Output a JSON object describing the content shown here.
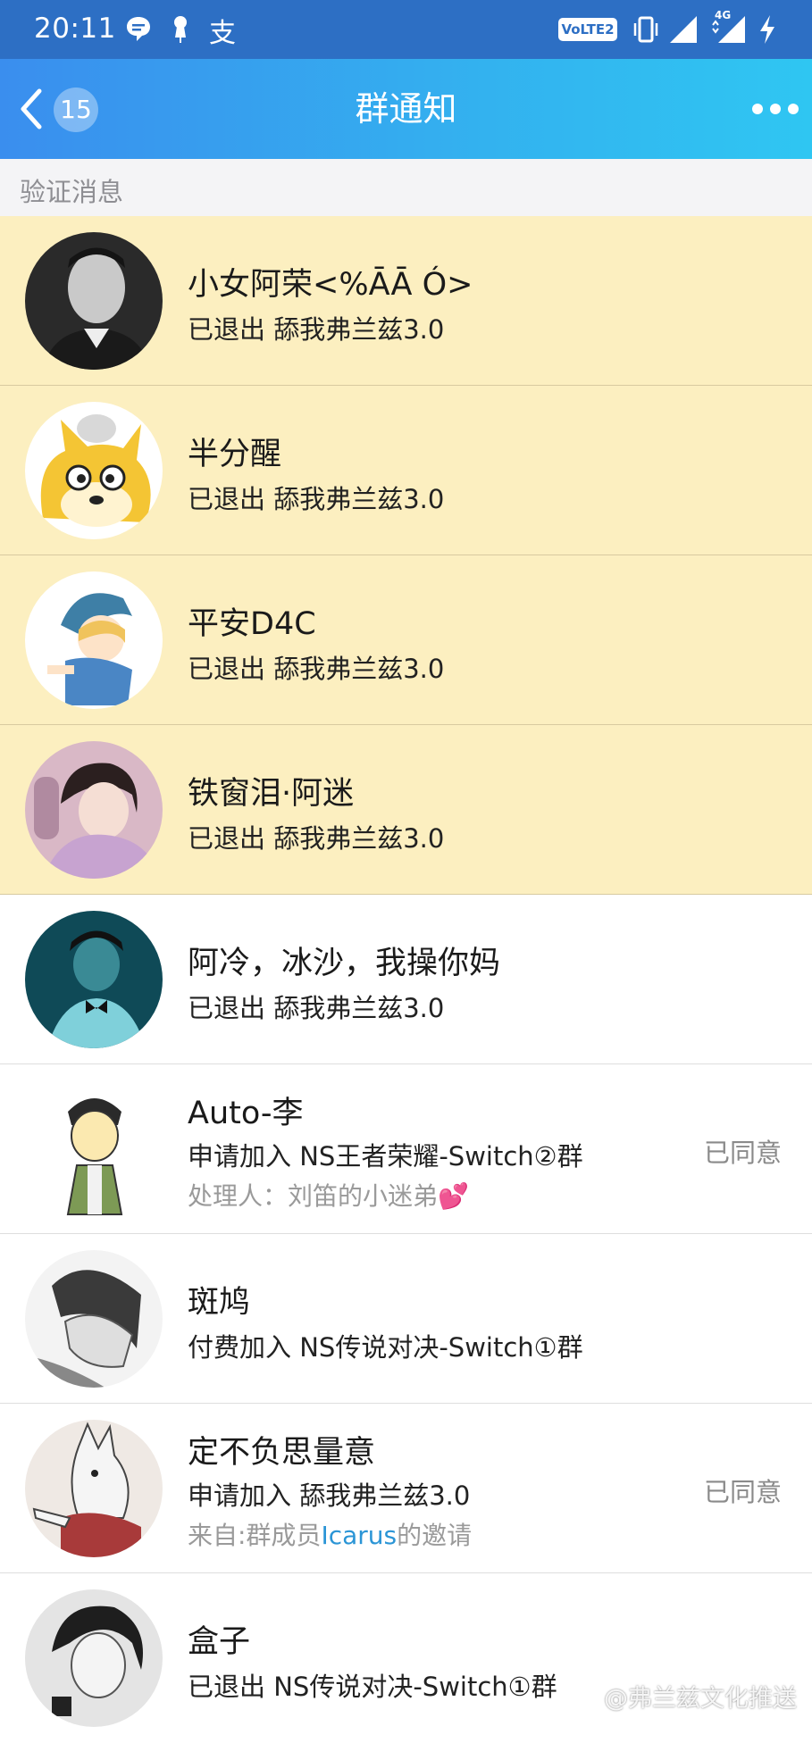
{
  "status_bar": {
    "time": "20:11",
    "volte_label": "VoLTE2",
    "network_label": "4G",
    "icons": [
      "chat-bubble-icon",
      "pin-icon",
      "alipay-icon",
      "vibrate-icon",
      "signal-icon",
      "signal-4g-icon",
      "charging-icon"
    ]
  },
  "header": {
    "back_badge": "15",
    "title": "群通知",
    "more_icon": "more-dots-icon"
  },
  "section": {
    "label": "验证消息"
  },
  "colors": {
    "highlight": "#fcefc0",
    "accent": "#33b2ef",
    "link": "#2b95d6"
  },
  "items": [
    {
      "name": "小女阿荣<%ĀĀ Ó>",
      "sub": "已退出 舔我弗兰兹3.0"
    },
    {
      "name": "半分醒",
      "sub": "已退出 舔我弗兰兹3.0"
    },
    {
      "name": "平安D4C",
      "sub": "已退出 舔我弗兰兹3.0"
    },
    {
      "name": "铁窗泪·阿迷",
      "sub": "已退出 舔我弗兰兹3.0"
    },
    {
      "name": "阿冷，冰沙，我操你妈",
      "sub": "已退出 舔我弗兰兹3.0"
    },
    {
      "name": "Auto-李",
      "sub": "申请加入 NS王者荣耀-Switch②群",
      "note": "处理人：刘笛的小迷弟💕",
      "status": "已同意"
    },
    {
      "name": "斑鸠",
      "sub": "付费加入 NS传说对决-Switch①群"
    },
    {
      "name": "定不负思量意",
      "sub": "申请加入 舔我弗兰兹3.0",
      "note_prefix": "来自:群成员",
      "note_link": "Icarus",
      "note_suffix": "的邀请",
      "status": "已同意"
    },
    {
      "name": "盒子",
      "sub": "已退出 NS传说对决-Switch①群"
    }
  ],
  "watermark": "@弗兰兹文化推送"
}
